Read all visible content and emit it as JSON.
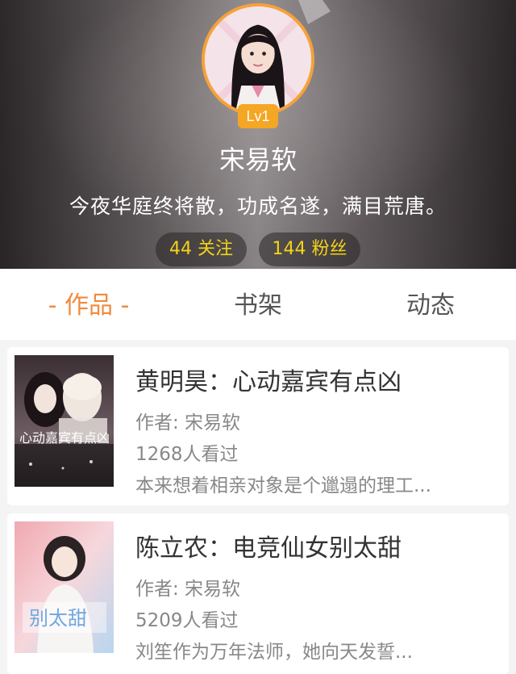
{
  "profile": {
    "level": "Lv1",
    "name": "宋易软",
    "bio": "今夜华庭终将散，功成名遂，满目荒唐。",
    "following": "44 关注",
    "fans": "144 粉丝"
  },
  "tabs": {
    "works": "- 作品 -",
    "shelf": "书架",
    "feed": "动态"
  },
  "books": [
    {
      "title": "黄明昊：心动嘉宾有点凶",
      "author": "作者: 宋易软",
      "views": "1268人看过",
      "desc": "本来想着相亲对象是个邋遢的理工...",
      "cover_text": "心动嘉宾有点凶"
    },
    {
      "title": "陈立农：电竞仙女别太甜",
      "author": "作者: 宋易软",
      "views": "5209人看过",
      "desc": "刘笙作为万年法师，她向天发誓...",
      "cover_text": "别太甜"
    }
  ],
  "colors": {
    "accent": "#f08a3c",
    "badge": "#f5a623",
    "stat_text": "#f3d21a"
  }
}
